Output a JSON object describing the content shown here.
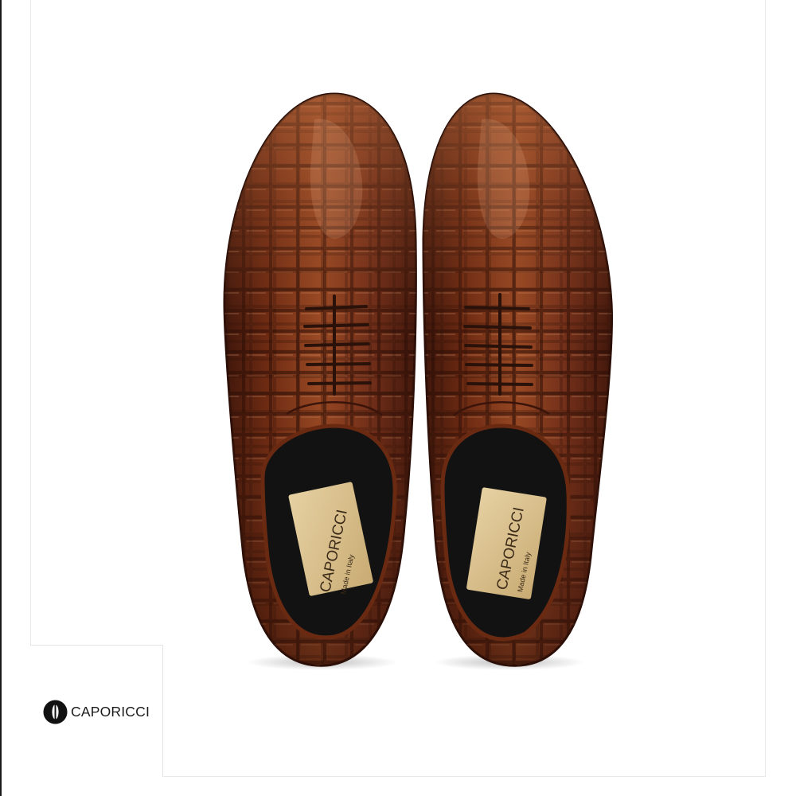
{
  "brand": {
    "name": "CAPORICCI",
    "insole_brand": "CAPORICCI",
    "insole_tagline": "Made in Italy"
  },
  "product": {
    "color": "#6a2f1a",
    "pattern": "croc-embossed leather",
    "view": "top-down pair"
  },
  "colors": {
    "leather_dark": "#3e160b",
    "leather_mid": "#7a3418",
    "leather_light": "#b0683f",
    "insole": "#d9c190",
    "lining": "#111111"
  },
  "icons": {
    "logo_mark": "caporicci-circle-mark-icon"
  }
}
